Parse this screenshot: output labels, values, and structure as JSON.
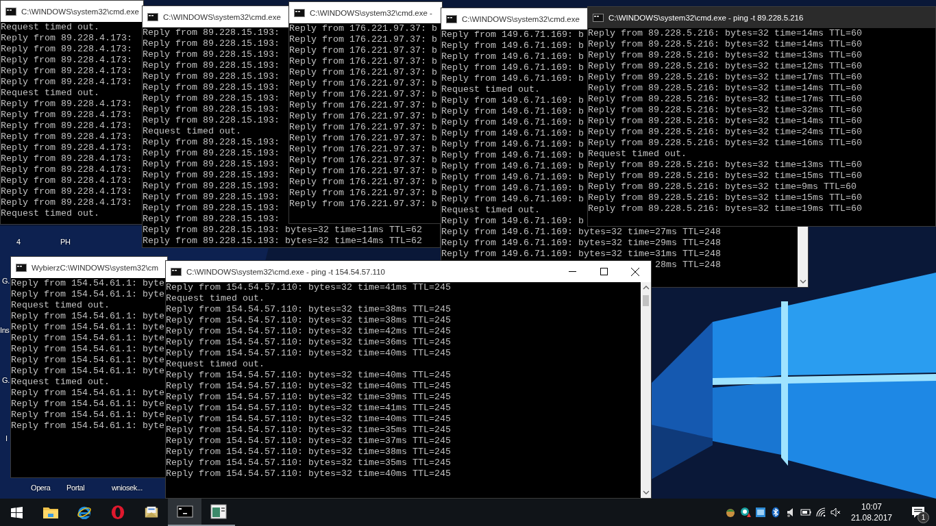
{
  "windows": [
    {
      "title": "C:\\WINDOWS\\system32\\cmd.exe",
      "active": false,
      "scrollbar": false,
      "lines": [
        "Request timed out.",
        "Reply from 89.228.4.173:",
        "Reply from 89.228.4.173:",
        "Reply from 89.228.4.173:",
        "Reply from 89.228.4.173:",
        "Reply from 89.228.4.173:",
        "Request timed out.",
        "Reply from 89.228.4.173:",
        "Reply from 89.228.4.173:",
        "Reply from 89.228.4.173:",
        "Reply from 89.228.4.173:",
        "Reply from 89.228.4.173:",
        "Reply from 89.228.4.173:",
        "Reply from 89.228.4.173:",
        "Reply from 89.228.4.173:",
        "Reply from 89.228.4.173:",
        "Reply from 89.228.4.173:",
        "Request timed out."
      ]
    },
    {
      "title": "C:\\WINDOWS\\system32\\cmd.exe",
      "active": false,
      "scrollbar": false,
      "lines": [
        "Reply from 89.228.15.193:",
        "Reply from 89.228.15.193:",
        "Reply from 89.228.15.193:",
        "Reply from 89.228.15.193:",
        "Reply from 89.228.15.193:",
        "Reply from 89.228.15.193:",
        "Reply from 89.228.15.193:",
        "Reply from 89.228.15.193:",
        "Reply from 89.228.15.193:",
        "Request timed out.",
        "Reply from 89.228.15.193:",
        "Reply from 89.228.15.193:",
        "Reply from 89.228.15.193:",
        "Reply from 89.228.15.193:",
        "Reply from 89.228.15.193:",
        "Reply from 89.228.15.193:",
        "Reply from 89.228.15.193:",
        "Reply from 89.228.15.193:",
        "Reply from 89.228.15.193: bytes=32 time=11ms TTL=62",
        "Reply from 89.228.15.193: bytes=32 time=14ms TTL=62"
      ]
    },
    {
      "title": "C:\\WINDOWS\\system32\\cmd.exe -",
      "active": false,
      "scrollbar": false,
      "lines": [
        "Reply from 176.221.97.37: b",
        "Reply from 176.221.97.37: b",
        "Reply from 176.221.97.37: b",
        "Reply from 176.221.97.37: b",
        "Reply from 176.221.97.37: b",
        "Reply from 176.221.97.37: b",
        "Reply from 176.221.97.37: b",
        "Reply from 176.221.97.37: b",
        "Reply from 176.221.97.37: b",
        "Reply from 176.221.97.37: b",
        "Reply from 176.221.97.37: b",
        "Reply from 176.221.97.37: b",
        "Reply from 176.221.97.37: b",
        "Reply from 176.221.97.37: b",
        "Reply from 176.221.97.37: b",
        "Reply from 176.221.97.37: b",
        "Reply from 176.221.97.37: b"
      ]
    },
    {
      "title": "C:\\WINDOWS\\system32\\cmd.exe",
      "active": false,
      "controls": false,
      "scrollbar": true,
      "tail_line": "28ms TTL=248",
      "lines": [
        "Reply from 149.6.71.169: b",
        "Reply from 149.6.71.169: b",
        "Reply from 149.6.71.169: b",
        "Reply from 149.6.71.169: b",
        "Reply from 149.6.71.169: b",
        "Request timed out.",
        "Reply from 149.6.71.169: b",
        "Reply from 149.6.71.169: b",
        "Reply from 149.6.71.169: b",
        "Reply from 149.6.71.169: b",
        "Reply from 149.6.71.169: b",
        "Reply from 149.6.71.169: b",
        "Reply from 149.6.71.169: b",
        "Reply from 149.6.71.169: b",
        "Reply from 149.6.71.169: b",
        "Reply from 149.6.71.169: b",
        "Request timed out.",
        "Reply from 149.6.71.169: b",
        "Reply from 149.6.71.169: bytes=32 time=27ms TTL=248",
        "Reply from 149.6.71.169: bytes=32 time=29ms TTL=248",
        "Reply from 149.6.71.169: bytes=32 time=31ms TTL=248"
      ]
    },
    {
      "title": "C:\\WINDOWS\\system32\\cmd.exe - ping  -t 89.228.5.216",
      "active": true,
      "controls": false,
      "scrollbar": false,
      "lines": [
        "Reply from 89.228.5.216: bytes=32 time=14ms TTL=60",
        "Reply from 89.228.5.216: bytes=32 time=14ms TTL=60",
        "Reply from 89.228.5.216: bytes=32 time=13ms TTL=60",
        "Reply from 89.228.5.216: bytes=32 time=12ms TTL=60",
        "Reply from 89.228.5.216: bytes=32 time=17ms TTL=60",
        "Reply from 89.228.5.216: bytes=32 time=14ms TTL=60",
        "Reply from 89.228.5.216: bytes=32 time=17ms TTL=60",
        "Reply from 89.228.5.216: bytes=32 time=32ms TTL=60",
        "Reply from 89.228.5.216: bytes=32 time=14ms TTL=60",
        "Reply from 89.228.5.216: bytes=32 time=24ms TTL=60",
        "Reply from 89.228.5.216: bytes=32 time=16ms TTL=60",
        "Request timed out.",
        "Reply from 89.228.5.216: bytes=32 time=13ms TTL=60",
        "Reply from 89.228.5.216: bytes=32 time=15ms TTL=60",
        "Reply from 89.228.5.216: bytes=32 time=9ms TTL=60",
        "Reply from 89.228.5.216: bytes=32 time=15ms TTL=60",
        "Reply from 89.228.5.216: bytes=32 time=19ms TTL=60"
      ]
    },
    {
      "title": "WybierzC:\\WINDOWS\\system32\\cm",
      "active": false,
      "scrollbar": false,
      "lines": [
        "Reply from 154.54.61.1: byte",
        "Reply from 154.54.61.1: byte",
        "Request timed out.",
        "Reply from 154.54.61.1: byte",
        "Reply from 154.54.61.1: byte",
        "Reply from 154.54.61.1: byte",
        "Reply from 154.54.61.1: byte",
        "Reply from 154.54.61.1: byte",
        "Reply from 154.54.61.1: byte",
        "Request timed out.",
        "Reply from 154.54.61.1: byte",
        "Reply from 154.54.61.1: byte",
        "Reply from 154.54.61.1: byte",
        "Reply from 154.54.61.1: byte"
      ]
    },
    {
      "title": "C:\\WINDOWS\\system32\\cmd.exe - ping  -t 154.54.57.110",
      "active": false,
      "controls": true,
      "scrollbar": true,
      "lines": [
        "Reply from 154.54.57.110: bytes=32 time=41ms TTL=245",
        "Request timed out.",
        "Reply from 154.54.57.110: bytes=32 time=38ms TTL=245",
        "Reply from 154.54.57.110: bytes=32 time=38ms TTL=245",
        "Reply from 154.54.57.110: bytes=32 time=42ms TTL=245",
        "Reply from 154.54.57.110: bytes=32 time=36ms TTL=245",
        "Reply from 154.54.57.110: bytes=32 time=40ms TTL=245",
        "Request timed out.",
        "Reply from 154.54.57.110: bytes=32 time=40ms TTL=245",
        "Reply from 154.54.57.110: bytes=32 time=40ms TTL=245",
        "Reply from 154.54.57.110: bytes=32 time=39ms TTL=245",
        "Reply from 154.54.57.110: bytes=32 time=41ms TTL=245",
        "Reply from 154.54.57.110: bytes=32 time=40ms TTL=245",
        "Reply from 154.54.57.110: bytes=32 time=35ms TTL=245",
        "Reply from 154.54.57.110: bytes=32 time=37ms TTL=245",
        "Reply from 154.54.57.110: bytes=32 time=38ms TTL=245",
        "Reply from 154.54.57.110: bytes=32 time=35ms TTL=245",
        "Reply from 154.54.57.110: bytes=32 time=40ms TTL=245"
      ]
    }
  ],
  "desktop_labels": [
    "4",
    "PH",
    "G.",
    "Ins",
    "G.",
    "I",
    "Opera",
    "Portal",
    "wniosek..."
  ],
  "taskbar": {
    "apps": [
      {
        "kind": "folder",
        "running": false,
        "selected": false
      },
      {
        "kind": "ie",
        "running": false,
        "selected": false
      },
      {
        "kind": "opera",
        "running": false,
        "selected": false
      },
      {
        "kind": "mail",
        "running": false,
        "selected": false
      },
      {
        "kind": "console",
        "running": true,
        "selected": true
      },
      {
        "kind": "panel",
        "running": true,
        "selected": false
      }
    ],
    "time": "10:07",
    "date": "21.08.2017",
    "notifications": "1"
  }
}
